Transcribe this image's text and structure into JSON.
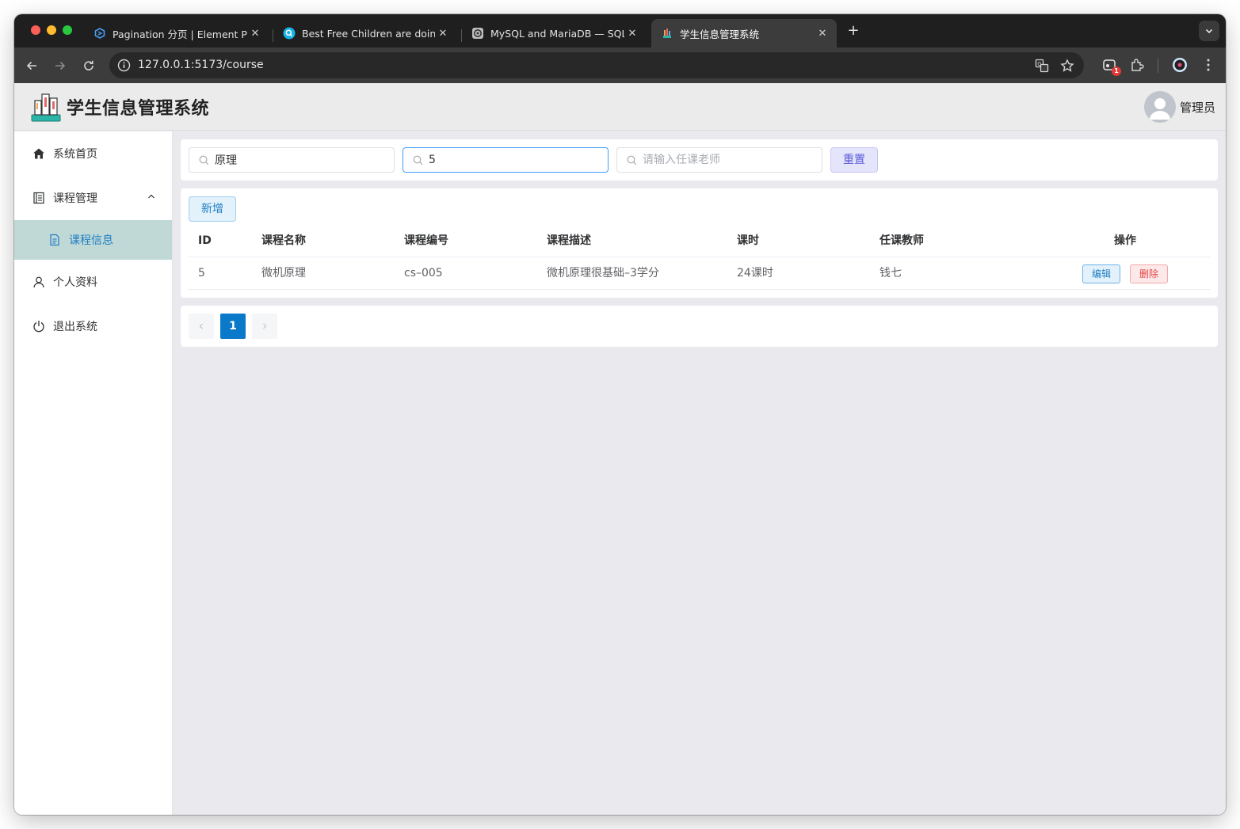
{
  "browser": {
    "tabs": [
      {
        "title": "Pagination 分页 | Element Plus",
        "icon": "element-plus-logo-icon",
        "active": false
      },
      {
        "title": "Best Free Children are doing",
        "icon": "search-bubble-icon",
        "active": false
      },
      {
        "title": "MySQL and MariaDB — SQLAlchemy",
        "icon": "sqlalchemy-icon",
        "active": false
      },
      {
        "title": "学生信息管理系统",
        "icon": "student-system-icon",
        "active": true
      }
    ],
    "url": "127.0.0.1:5173/course",
    "extension_badge": "1"
  },
  "header": {
    "title": "学生信息管理系统",
    "user": "管理员"
  },
  "sidebar": {
    "items": [
      {
        "label": "系统首页",
        "icon": "home-icon"
      },
      {
        "label": "课程管理",
        "icon": "document-list-icon",
        "expanded": true
      },
      {
        "label": "课程信息",
        "icon": "document-icon",
        "active": true
      },
      {
        "label": "个人资料",
        "icon": "user-icon"
      },
      {
        "label": "退出系统",
        "icon": "power-icon"
      }
    ]
  },
  "search": {
    "name_value": "原理",
    "code_value": "5",
    "teacher_placeholder": "请输入任课老师",
    "reset_label": "重置"
  },
  "toolbar": {
    "add_label": "新增"
  },
  "table": {
    "columns": [
      "ID",
      "课程名称",
      "课程编号",
      "课程描述",
      "课时",
      "任课教师",
      "操作"
    ],
    "rows": [
      {
        "id": "5",
        "name": "微机原理",
        "code": "cs–005",
        "description": "微机原理很基础–3学分",
        "hours": "24课时",
        "teacher": "钱七",
        "edit_label": "编辑",
        "delete_label": "删除"
      }
    ]
  },
  "pagination": {
    "current_page": "1",
    "prev_icon": "chevron-left-icon",
    "next_icon": "chevron-right-icon"
  },
  "colors": {
    "primary": "#0a79c9",
    "active_menu_bg": "#c1d9d6",
    "danger": "#e54545"
  }
}
